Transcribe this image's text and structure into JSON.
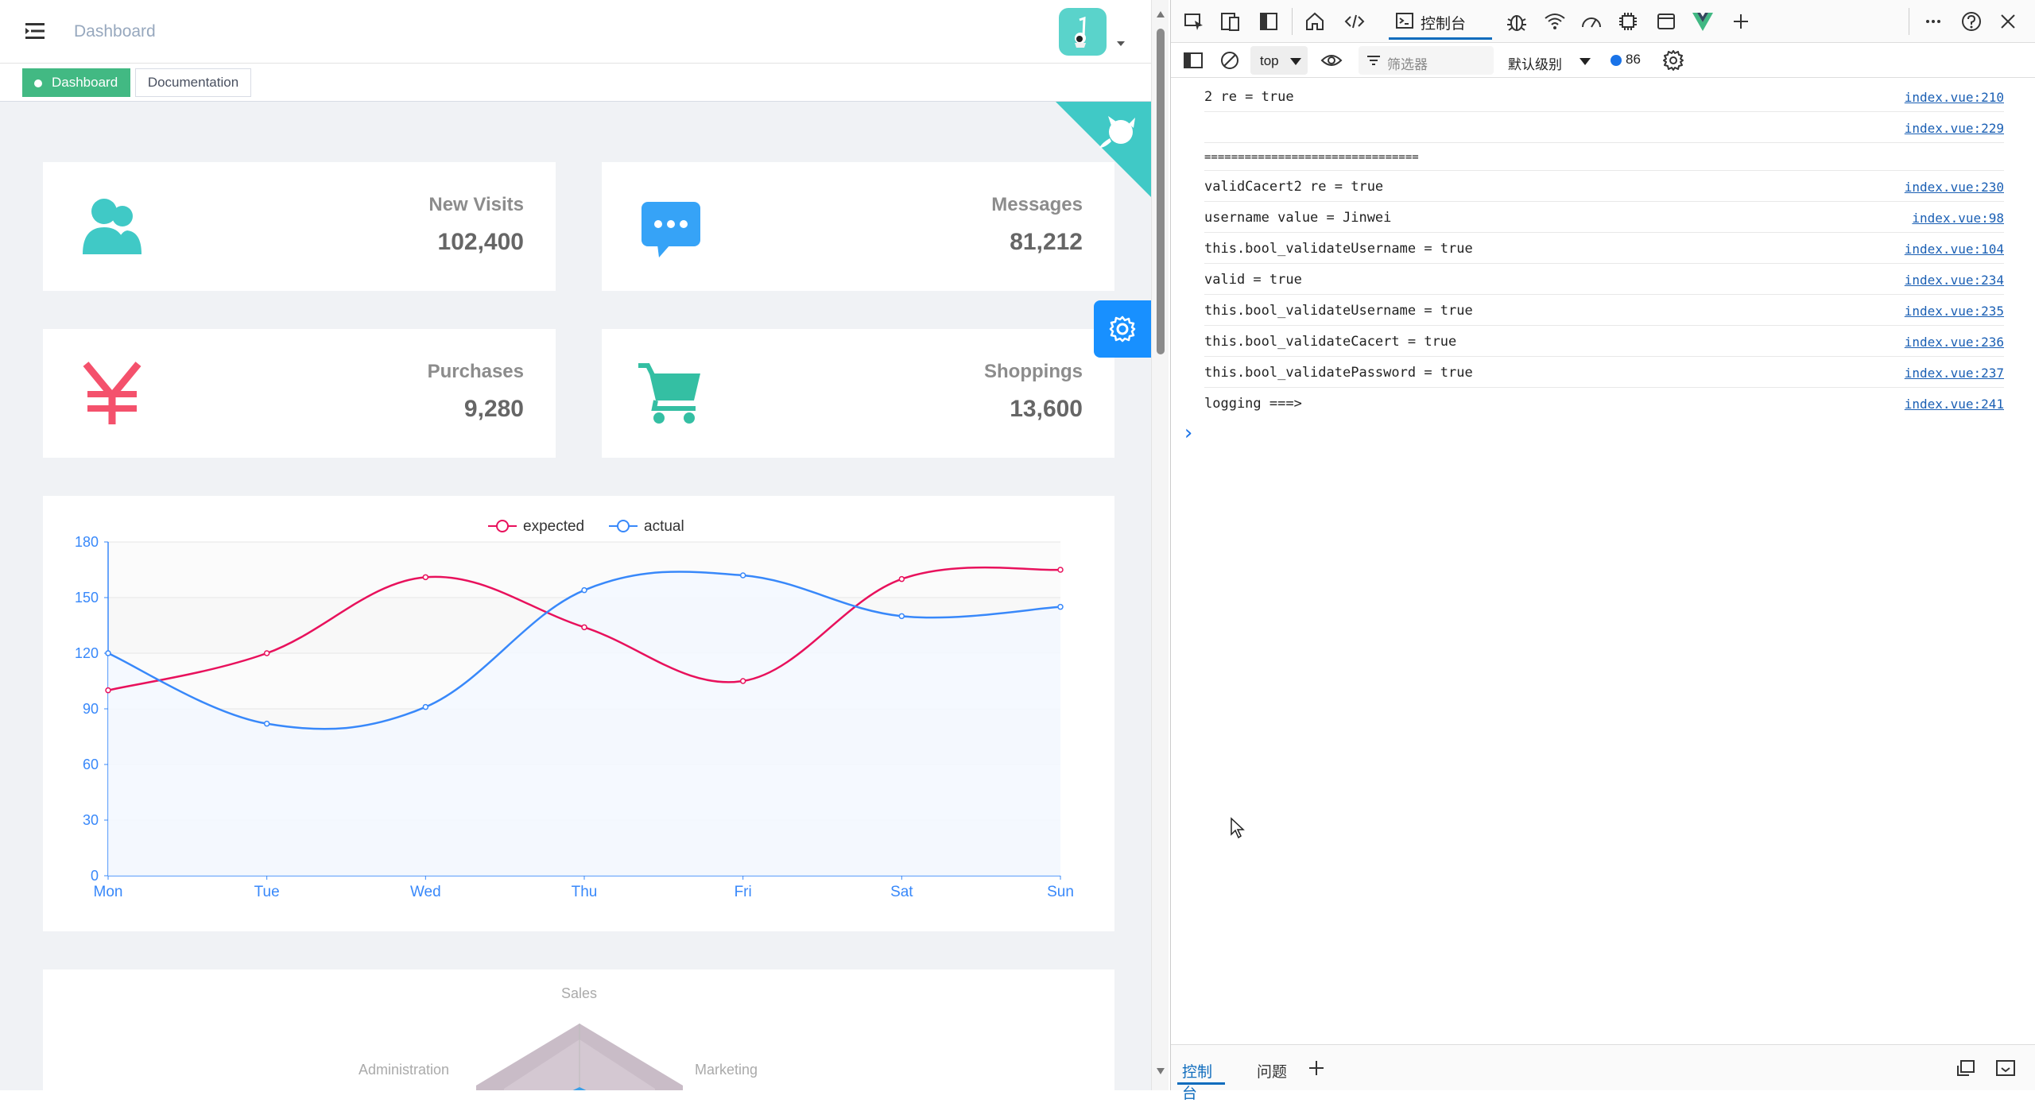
{
  "navbar": {
    "breadcrumb": "Dashboard"
  },
  "tags": {
    "active": "Dashboard",
    "other": "Documentation"
  },
  "stats": [
    {
      "label": "New Visits",
      "value": "102,400",
      "icon": "peoples-icon",
      "color": "#40c9c6"
    },
    {
      "label": "Messages",
      "value": "81,212",
      "icon": "message-icon",
      "color": "#36a3f7"
    },
    {
      "label": "Purchases",
      "value": "9,280",
      "icon": "yen-icon",
      "color": "#f4516c"
    },
    {
      "label": "Shoppings",
      "value": "13,600",
      "icon": "shopping-cart-icon",
      "color": "#34bfa3"
    }
  ],
  "chart_data": {
    "type": "line",
    "categories": [
      "Mon",
      "Tue",
      "Wed",
      "Thu",
      "Fri",
      "Sat",
      "Sun"
    ],
    "series": [
      {
        "name": "expected",
        "values": [
          100,
          120,
          161,
          134,
          105,
          160,
          165
        ],
        "color": "#e8115c"
      },
      {
        "name": "actual",
        "values": [
          120,
          82,
          91,
          154,
          162,
          140,
          145
        ],
        "color": "#3888fa"
      }
    ],
    "yticks": [
      "0",
      "30",
      "60",
      "90",
      "120",
      "150",
      "180"
    ],
    "ylim": [
      0,
      180
    ],
    "legend": "top-center"
  },
  "radar": {
    "labels": [
      "Sales",
      "Administration",
      "Marketing"
    ]
  },
  "devtools": {
    "tabs": {
      "console": "控制台"
    },
    "context": "top",
    "filter_placeholder": "筛选器",
    "level": "默认级别",
    "message_count": "86",
    "prompt": "›",
    "bottom_tabs": {
      "console": "控制台",
      "issues": "问题"
    },
    "logs": [
      {
        "msg": "2 re = true",
        "src": "index.vue:210"
      },
      {
        "msg": "",
        "src": "index.vue:229"
      },
      {
        "msg": "================================",
        "src": ""
      },
      {
        "msg": "validCacert2 re = true",
        "src": "index.vue:230"
      },
      {
        "msg": "username value = Jinwei",
        "src": "index.vue:98"
      },
      {
        "msg": "this.bool_validateUsername = true",
        "src": "index.vue:104"
      },
      {
        "msg": "valid = true",
        "src": "index.vue:234"
      },
      {
        "msg": "this.bool_validateUsername = true",
        "src": "index.vue:235"
      },
      {
        "msg": "this.bool_validateCacert = true",
        "src": "index.vue:236"
      },
      {
        "msg": "this.bool_validatePassword = true",
        "src": "index.vue:237"
      },
      {
        "msg": "logging ===>",
        "src": "index.vue:241"
      }
    ]
  }
}
